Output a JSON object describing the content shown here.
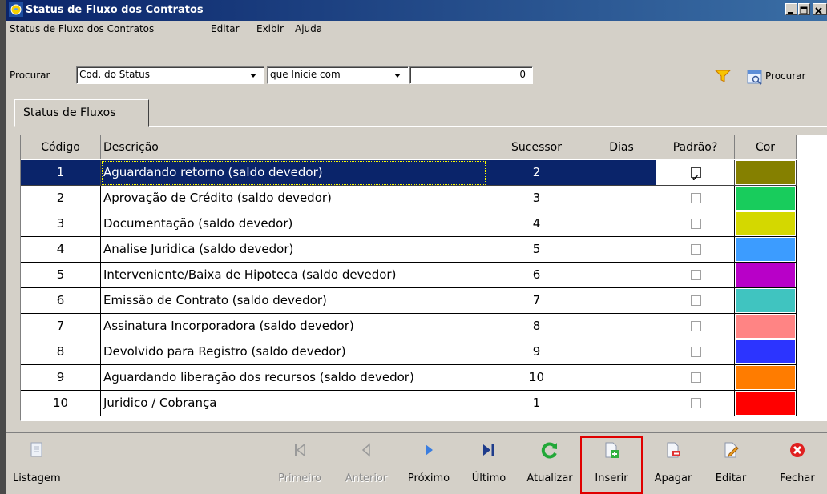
{
  "window": {
    "title": "Status de Fluxo dos Contratos"
  },
  "menu": [
    "Status de Fluxo dos Contratos",
    "Editar",
    "Exibir",
    "Ajuda"
  ],
  "search": {
    "label": "Procurar",
    "field_value": "Cod. do Status",
    "condition_value": "que Inicie com",
    "input_value": "0",
    "button_label": "Procurar"
  },
  "tab_label": "Status de Fluxos",
  "columns": [
    "Código",
    "Descrição",
    "Sucessor",
    "Dias",
    "Padrão?",
    "Cor"
  ],
  "rows": [
    {
      "codigo": "1",
      "descricao": "Aguardando retorno (saldo devedor)",
      "sucessor": "2",
      "dias": "",
      "padrao": true,
      "cor": "#858000",
      "selected": true
    },
    {
      "codigo": "2",
      "descricao": "Aprovação de Crédito (saldo devedor)",
      "sucessor": "3",
      "dias": "",
      "padrao": false,
      "cor": "#18cc5c"
    },
    {
      "codigo": "3",
      "descricao": "Documentação (saldo devedor)",
      "sucessor": "4",
      "dias": "",
      "padrao": false,
      "cor": "#d4d800"
    },
    {
      "codigo": "4",
      "descricao": "Analise Juridica (saldo devedor)",
      "sucessor": "5",
      "dias": "",
      "padrao": false,
      "cor": "#3c9cff"
    },
    {
      "codigo": "5",
      "descricao": "Interveniente/Baixa de Hipoteca (saldo devedor)",
      "sucessor": "6",
      "dias": "",
      "padrao": false,
      "cor": "#b800c8"
    },
    {
      "codigo": "6",
      "descricao": "Emissão de Contrato (saldo devedor)",
      "sucessor": "7",
      "dias": "",
      "padrao": false,
      "cor": "#40c4c0"
    },
    {
      "codigo": "7",
      "descricao": "Assinatura Incorporadora (saldo devedor)",
      "sucessor": "8",
      "dias": "",
      "padrao": false,
      "cor": "#ff8484"
    },
    {
      "codigo": "8",
      "descricao": "Devolvido para Registro (saldo devedor)",
      "sucessor": "9",
      "dias": "",
      "padrao": false,
      "cor": "#2c34ff"
    },
    {
      "codigo": "9",
      "descricao": "Aguardando liberação dos recursos (saldo devedor)",
      "sucessor": "10",
      "dias": "",
      "padrao": false,
      "cor": "#ff7c00"
    },
    {
      "codigo": "10",
      "descricao": "Juridico / Cobrança",
      "sucessor": "1",
      "dias": "",
      "padrao": false,
      "cor": "#ff0000"
    }
  ],
  "toolbar": {
    "listagem": "Listagem",
    "primeiro": "Primeiro",
    "anterior": "Anterior",
    "proximo": "Próximo",
    "ultimo": "Último",
    "atualizar": "Atualizar",
    "inserir": "Inserir",
    "apagar": "Apagar",
    "editar": "Editar",
    "fechar": "Fechar"
  },
  "colors": {
    "title_bar": "#0a246a",
    "selection": "#0a246a",
    "highlight_box": "#e00000",
    "window_bg": "#d4d0c8"
  }
}
